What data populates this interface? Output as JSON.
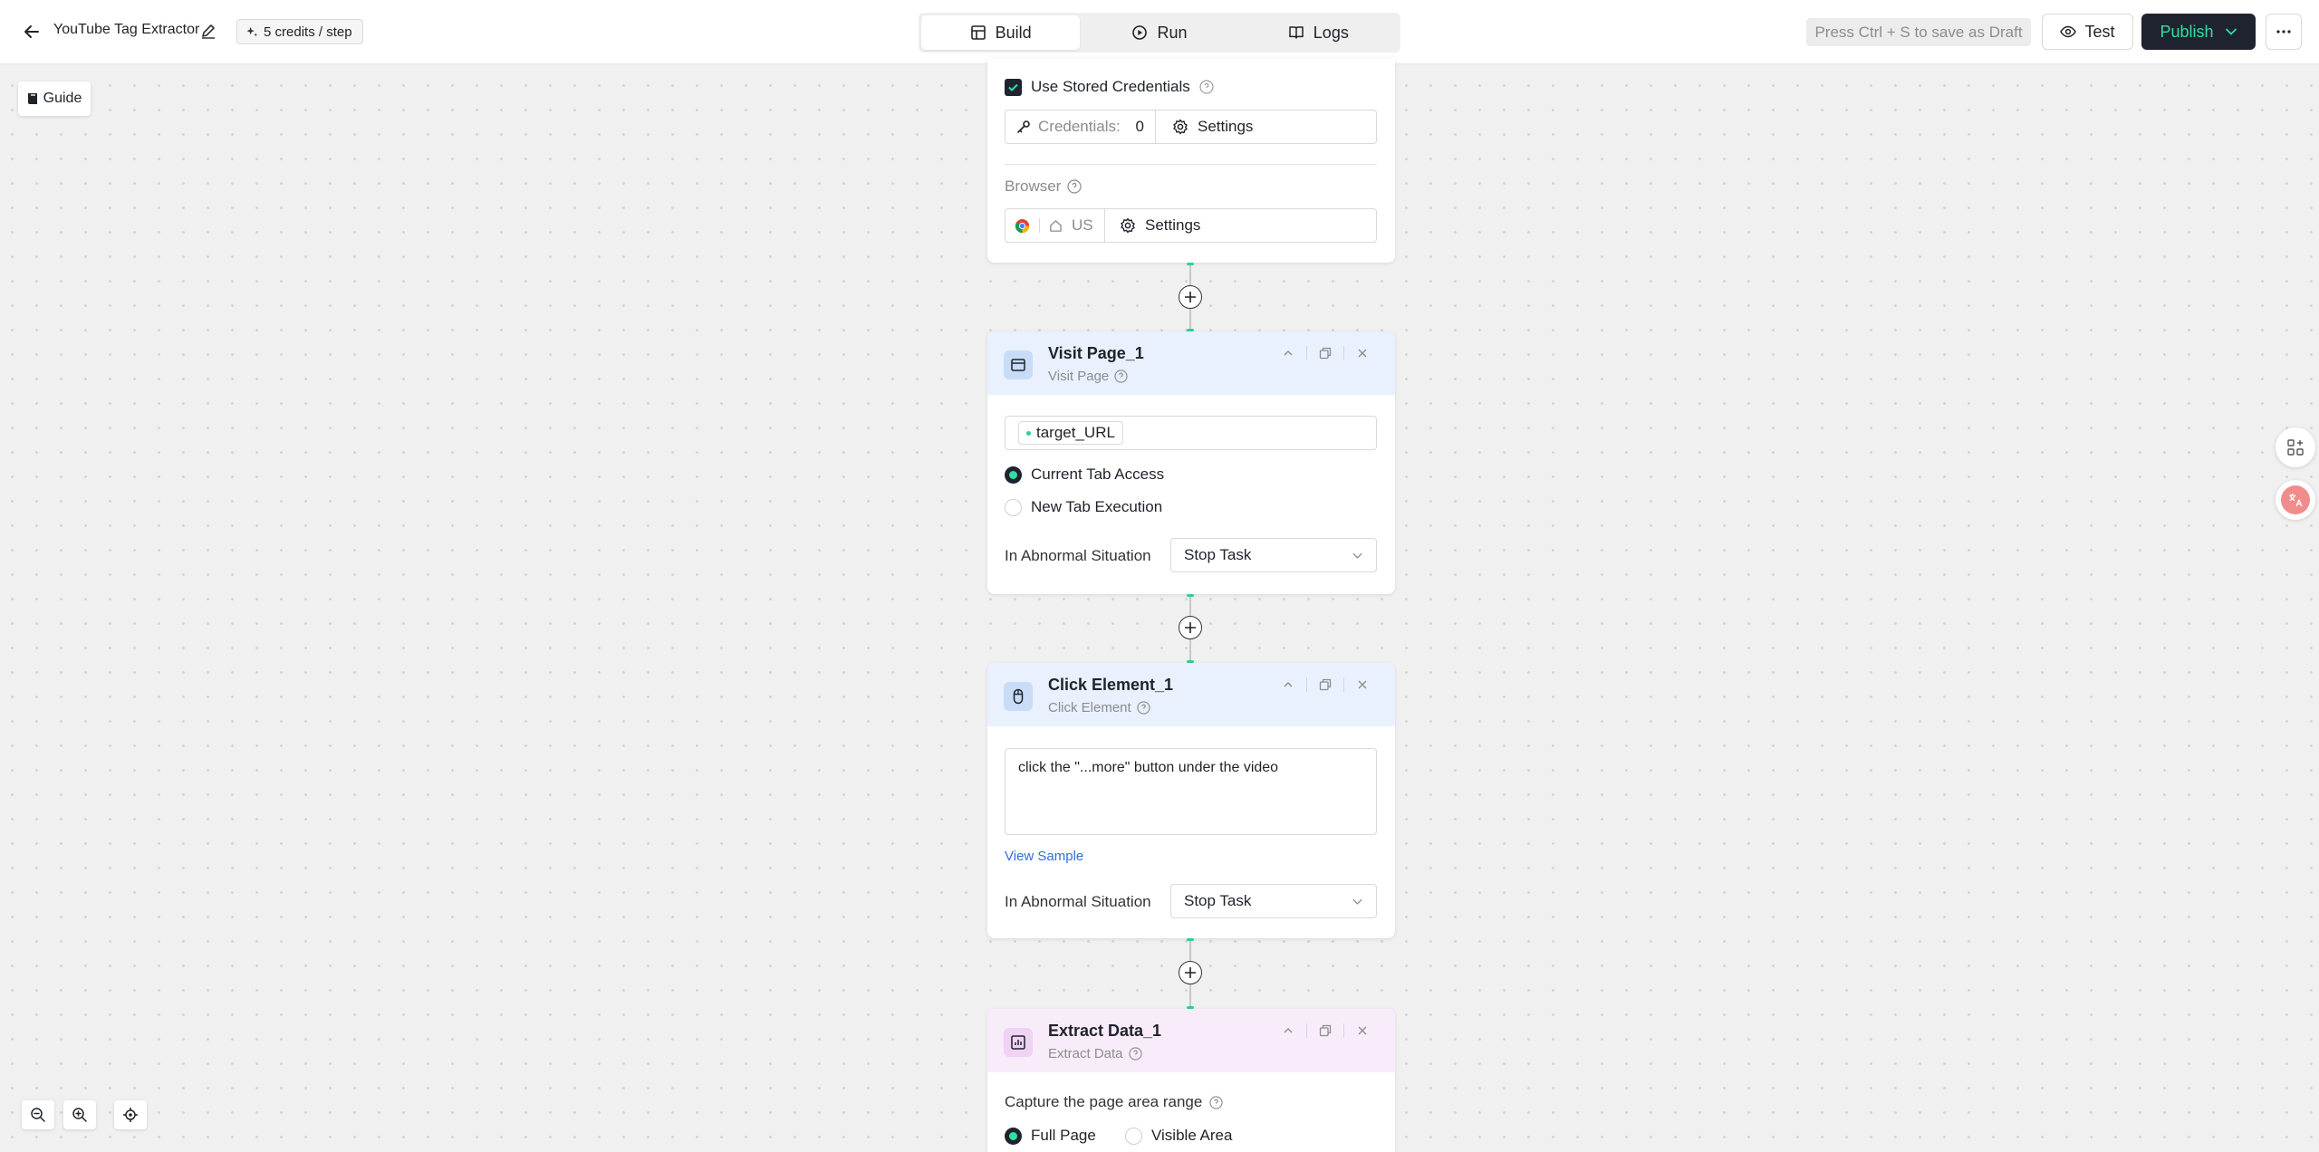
{
  "header": {
    "app_title": "YouTube Tag Extractor",
    "credits": "5 credits / step",
    "tabs": [
      {
        "label": "Build",
        "icon": "layout-icon",
        "active": true
      },
      {
        "label": "Run",
        "icon": "play-circle-icon",
        "active": false
      },
      {
        "label": "Logs",
        "icon": "book-icon",
        "active": false
      }
    ],
    "draft_hint": "Press Ctrl + S to save as Draft",
    "test_label": "Test",
    "publish_label": "Publish"
  },
  "guide_label": "Guide",
  "browser_card": {
    "use_stored_credentials": "Use Stored Credentials",
    "credentials_label": "Credentials:",
    "credentials_count": "0",
    "credentials_settings": "Settings",
    "browser_label": "Browser",
    "region": "US",
    "browser_settings": "Settings"
  },
  "visit_page": {
    "title": "Visit Page_1",
    "subtitle": "Visit Page",
    "url_variable": "target_URL",
    "options": [
      "Current Tab Access",
      "New Tab Execution"
    ],
    "selected_option": "Current Tab Access",
    "abnormal_label": "In Abnormal Situation",
    "abnormal_value": "Stop Task"
  },
  "click_element": {
    "title": "Click Element_1",
    "subtitle": "Click Element",
    "instruction": "click the \"...more\" button under the video",
    "view_sample": "View Sample",
    "abnormal_label": "In Abnormal Situation",
    "abnormal_value": "Stop Task"
  },
  "extract_data": {
    "title": "Extract Data_1",
    "subtitle": "Extract Data",
    "capture_label": "Capture the page area range",
    "options": [
      "Full Page",
      "Visible Area"
    ],
    "selected_option": "Full Page"
  },
  "colors": {
    "accent_green": "#2fe0a0",
    "dark": "#1f2330",
    "link_blue": "#2f6fdc",
    "node_blue_bg": "#e8f1fd",
    "node_purple_bg": "#f8ecfb"
  }
}
